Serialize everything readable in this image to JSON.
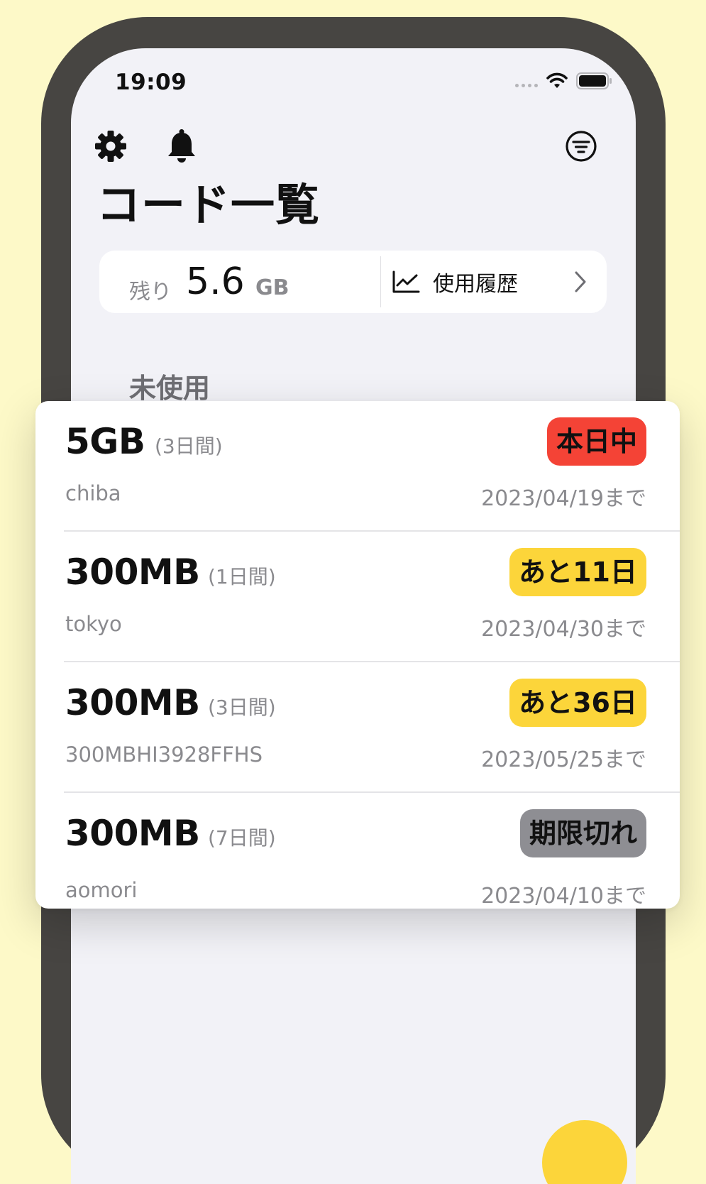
{
  "status_bar": {
    "time": "19:09"
  },
  "header": {
    "settings_icon": "gear-icon",
    "notifications_icon": "bell-icon",
    "filter_icon": "filter-circle-icon",
    "title": "コード一覧"
  },
  "data_card": {
    "remain_label": "残り",
    "remain_value": "5.6",
    "remain_unit": "GB",
    "history_label": "使用履歴",
    "history_icon": "line-chart-icon",
    "chevron_icon": "chevron-right-icon"
  },
  "section": {
    "title": "未使用"
  },
  "codes": [
    {
      "size": "5GB",
      "duration": "(3日間)",
      "name": "chiba",
      "badge": "本日中",
      "badge_color": "#f44336",
      "expiry": "2023/04/19まで"
    },
    {
      "size": "300MB",
      "duration": "(1日間)",
      "name": "tokyo",
      "badge": "あと11日",
      "badge_color": "#fcd53a",
      "expiry": "2023/04/30まで"
    },
    {
      "size": "300MB",
      "duration": "(3日間)",
      "name": "300MBHI3928FFHS",
      "badge": "あと36日",
      "badge_color": "#fcd53a",
      "expiry": "2023/05/25まで"
    },
    {
      "size": "300MB",
      "duration": "(7日間)",
      "name": "aomori",
      "badge": "期限切れ",
      "badge_color": "#8e8e93",
      "expiry": "2023/04/10まで"
    }
  ],
  "colors": {
    "background": "#fdf9c8",
    "phone_frame": "#474542",
    "screen": "#f2f2f7",
    "accent_yellow": "#fcd53a",
    "alert_red": "#f44336",
    "expired_gray": "#8e8e93"
  }
}
